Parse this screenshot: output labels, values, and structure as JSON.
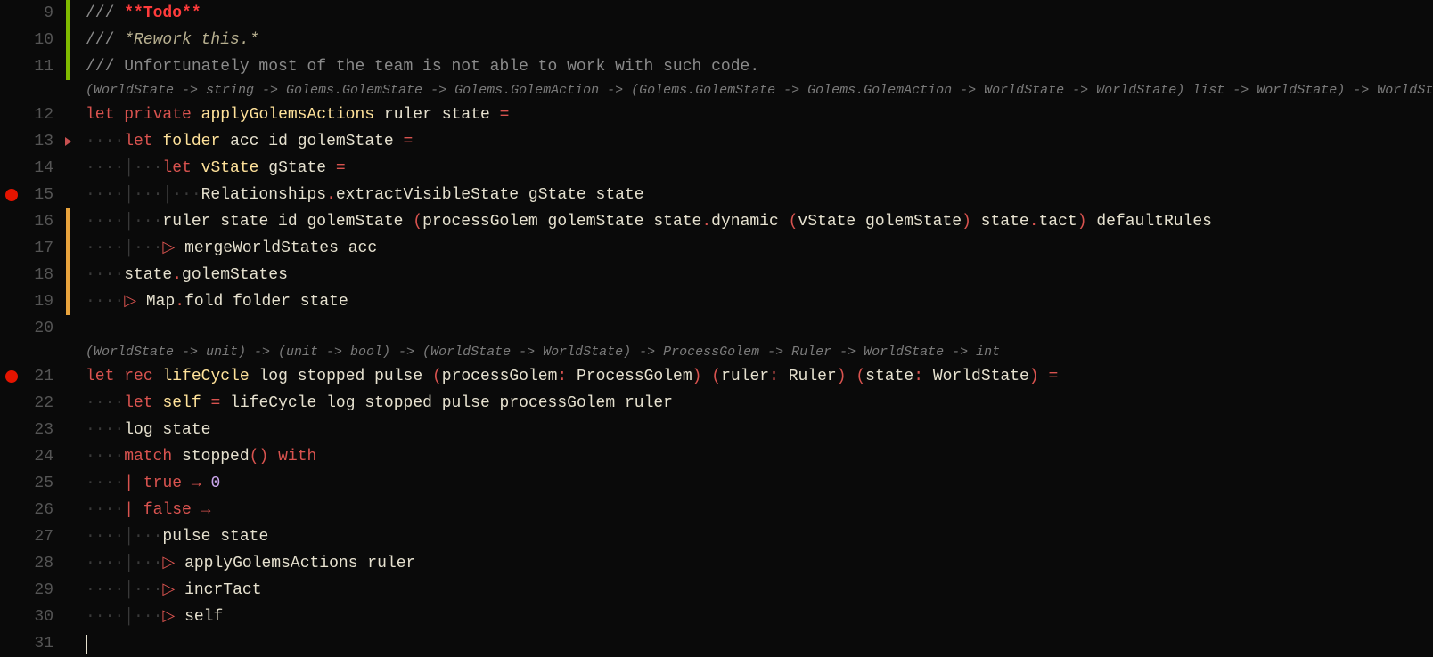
{
  "gutter": {
    "lines": [
      "9",
      "10",
      "11",
      "",
      "12",
      "13",
      "14",
      "15",
      "16",
      "17",
      "18",
      "19",
      "20",
      "",
      "21",
      "22",
      "23",
      "24",
      "25",
      "26",
      "27",
      "28",
      "29",
      "30",
      "31"
    ],
    "breakpoints": [
      15,
      21
    ]
  },
  "marks": {
    "green": [
      9,
      10,
      11
    ],
    "orange": [
      16,
      17,
      18,
      19
    ],
    "caret": [
      13
    ]
  },
  "hints": {
    "h1": "(WorldState -> string -> Golems.GolemState -> Golems.GolemAction -> (Golems.GolemState -> Golems.GolemAction -> WorldState -> WorldState) list -> WorldState) -> WorldState",
    "h2": "(WorldState -> unit) -> (unit -> bool) -> (WorldState -> WorldState) -> ProcessGolem -> Ruler -> WorldState -> int"
  },
  "code": {
    "l9": {
      "prefix": "/// ",
      "todo": "**Todo**"
    },
    "l10": {
      "prefix": "/// ",
      "rework": "*Rework this.*"
    },
    "l11": "/// Unfortunately most of the team is not able to work with such code.",
    "l12": {
      "kw1": "let",
      "kw2": "private",
      "fn": "applyGolemsActions",
      "p1": "ruler",
      "p2": "state",
      "eq": "="
    },
    "l13": {
      "kw": "let",
      "fn": "folder",
      "p1": "acc",
      "p2": "id",
      "p3": "golemState",
      "eq": "="
    },
    "l14": {
      "kw": "let",
      "fn": "vState",
      "p1": "gState",
      "eq": "="
    },
    "l15": {
      "mod": "Relationships",
      "dot": ".",
      "fn": "extractVisibleState",
      "a1": "gState",
      "a2": "state"
    },
    "l16": {
      "text": "ruler state id golemState ",
      "lp": "(",
      "fn": "processGolem",
      "mid": " golemState state",
      "dot1": ".",
      "m1": "dynamic",
      "sp": " ",
      "lp2": "(",
      "v": "vState golemState",
      "rp2": ")",
      "sp2": " state",
      "dot2": ".",
      "m2": "tact",
      "rp": ")",
      "tail": " defaultRules"
    },
    "l17": {
      "pipe": "▷",
      "fn": "mergeWorldStates",
      "a": "acc"
    },
    "l18": {
      "id": "state",
      "dot": ".",
      "m": "golemStates"
    },
    "l19": {
      "pipe": "▷",
      "mod": "Map",
      "dot": ".",
      "fn": "fold",
      "a1": "folder",
      "a2": "state"
    },
    "l21": {
      "kw1": "let",
      "kw2": "rec",
      "fn": "lifeCycle",
      "p1": "log",
      "p2": "stopped",
      "p3": "pulse",
      "lp1": "(",
      "pn1": "processGolem",
      "col1": ":",
      "ty1": "ProcessGolem",
      "rp1": ")",
      "lp2": "(",
      "pn2": "ruler",
      "col2": ":",
      "ty2": "Ruler",
      "rp2": ")",
      "lp3": "(",
      "pn3": "state",
      "col3": ":",
      "ty3": "WorldState",
      "rp3": ")",
      "eq": "="
    },
    "l22": {
      "kw": "let",
      "fn": "self",
      "eq": "=",
      "rhs": "lifeCycle log stopped pulse processGolem ruler"
    },
    "l23": {
      "t": "log state"
    },
    "l24": {
      "kw1": "match",
      "id": "stopped",
      "par": "()",
      "kw2": "with"
    },
    "l25": {
      "bar": "|",
      "v": "true",
      "arr": "→",
      "n": "0"
    },
    "l26": {
      "bar": "|",
      "v": "false",
      "arr": "→"
    },
    "l27": {
      "t": "pulse state"
    },
    "l28": {
      "pipe": "▷",
      "t": "applyGolemsActions ruler"
    },
    "l29": {
      "pipe": "▷",
      "t": "incrTact"
    },
    "l30": {
      "pipe": "▷",
      "t": "self"
    }
  },
  "indent": {
    "d1": "····",
    "d2": "····│···",
    "d3": "····│···│···",
    "d4": "····│···│···│···"
  }
}
